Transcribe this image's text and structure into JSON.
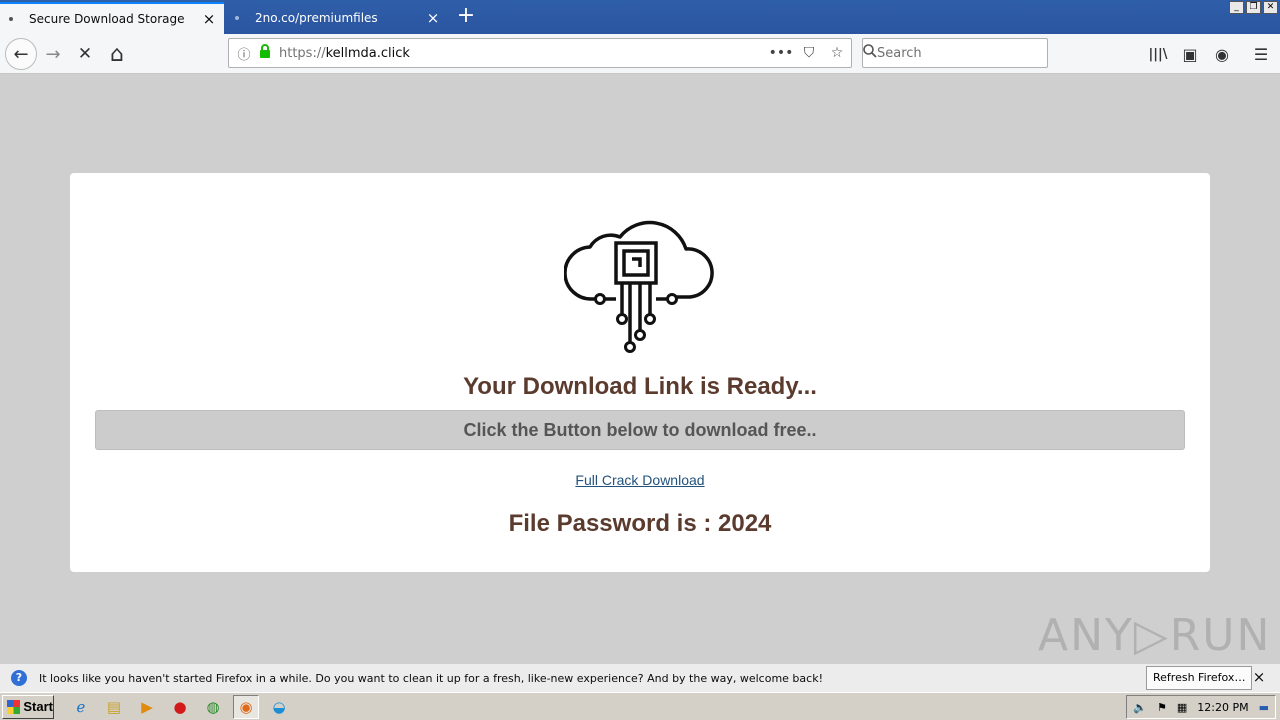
{
  "browser": {
    "tabs": [
      {
        "title": "Secure Download Storage",
        "close_icon": "×"
      },
      {
        "title": "2no.co/premiumfiles",
        "close_icon": "×"
      }
    ],
    "new_tab_icon": "+",
    "url": {
      "scheme": "https://",
      "host": "kellmda.click"
    },
    "search_placeholder": "Search",
    "icons": {
      "back": "←",
      "forward": "→",
      "stop": "✕",
      "home": "⌂",
      "info": "ⓘ",
      "lock": "🔒",
      "page_actions": "•••",
      "pocket": "⛉",
      "bookmark": "☆",
      "search": "🔍",
      "library": "|||\\",
      "sidebar": "▣",
      "account": "◉",
      "menu": "☰"
    }
  },
  "page": {
    "headline": "Your Download Link is Ready...",
    "subheading": "Click the Button below to download free..",
    "download_link": "Full Crack Download",
    "password_text": "File Password is : 2024",
    "watermark": "ANY▷RUN"
  },
  "notification": {
    "message": "It looks like you haven't started Firefox in a while. Do you want to clean it up for a fresh, like-new experience? And by the way, welcome back!",
    "button": "Refresh Firefox…",
    "close_icon": "×"
  },
  "taskbar": {
    "start_label": "Start",
    "clock": "12:20 PM"
  },
  "colors": {
    "tab_strip": "#2b55a0",
    "page_background": "#cfcfcf",
    "heading_text": "#5a3b2e",
    "link": "#23527c",
    "lock_green": "#12bc00"
  }
}
